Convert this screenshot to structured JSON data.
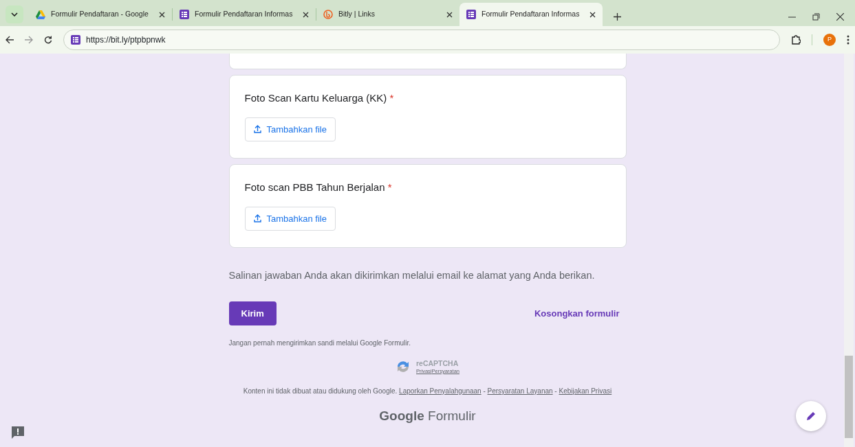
{
  "browser": {
    "tabs": [
      {
        "title": "Formulir Pendaftaran - Google",
        "kind": "drive",
        "selected": false
      },
      {
        "title": "Formulir Pendaftaran Informas",
        "kind": "forms",
        "selected": false
      },
      {
        "title": "Bitly | Links",
        "kind": "bitly",
        "selected": false
      },
      {
        "title": "Formulir Pendaftaran Informas",
        "kind": "forms",
        "selected": true
      }
    ],
    "url": "https://bit.ly/ptpbpnwk",
    "profile_initial": "P"
  },
  "form": {
    "questions": [
      {
        "label": "Foto Scan Kartu Keluarga (KK)",
        "required_mark": "*",
        "upload_button": "Tambahkan file"
      },
      {
        "label": "Foto scan PBB Tahun Berjalan",
        "required_mark": "*",
        "upload_button": "Tambahkan file"
      }
    ],
    "copy_note": "Salinan jawaban Anda akan dikirimkan melalui email ke alamat yang Anda berikan.",
    "submit_button": "Kirim",
    "clear_button": "Kosongkan formulir",
    "password_warning": "Jangan pernah mengirimkan sandi melalui Google Formulir.",
    "recaptcha": {
      "title": "reCAPTCHA",
      "links": [
        "Privasi",
        "Persyaratan"
      ]
    },
    "disclaimer": {
      "text": "Konten ini tidak dibuat atau didukung oleh Google.",
      "links": [
        "Laporkan Penyalahgunaan",
        "Persyaratan Layanan",
        "Kebijakan Privasi"
      ],
      "separator": "-"
    },
    "brand": {
      "google": "Google",
      "product": "Formulir"
    }
  }
}
